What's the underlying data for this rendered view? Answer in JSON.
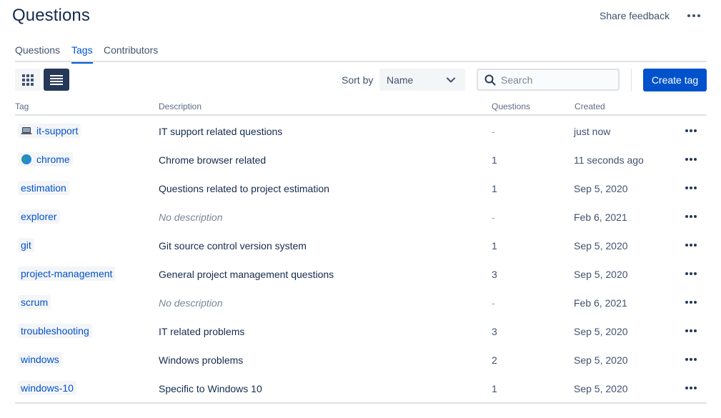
{
  "header": {
    "title": "Questions",
    "share_feedback": "Share feedback",
    "more_icon": "more-horizontal-icon"
  },
  "tabs": [
    {
      "label": "Questions",
      "active": false
    },
    {
      "label": "Tags",
      "active": true
    },
    {
      "label": "Contributors",
      "active": false
    }
  ],
  "toolbar": {
    "grid_view_icon": "grid-view-icon",
    "list_view_icon": "list-view-icon",
    "active_view": "list",
    "sort_label": "Sort by",
    "sort_value": "Name",
    "search_placeholder": "Search",
    "search_value": "",
    "create_label": "Create tag"
  },
  "table": {
    "columns": [
      "Tag",
      "Description",
      "Questions",
      "Created"
    ],
    "rows": [
      {
        "tag": "it-support",
        "icon": "laptop-icon",
        "description": "IT support related questions",
        "questions": "-",
        "created": "just now"
      },
      {
        "tag": "chrome",
        "icon": "globe-icon",
        "description": "Chrome browser related",
        "questions": "1",
        "created": "11 seconds ago"
      },
      {
        "tag": "estimation",
        "icon": "",
        "description": "Questions related to project estimation",
        "questions": "1",
        "created": "Sep 5, 2020"
      },
      {
        "tag": "explorer",
        "icon": "",
        "description": "No description",
        "questions": "-",
        "created": "Feb 6, 2021"
      },
      {
        "tag": "git",
        "icon": "",
        "description": "Git source control version system",
        "questions": "1",
        "created": "Sep 5, 2020"
      },
      {
        "tag": "project-management",
        "icon": "",
        "description": "General project management questions",
        "questions": "3",
        "created": "Sep 5, 2020"
      },
      {
        "tag": "scrum",
        "icon": "",
        "description": "No description",
        "questions": "-",
        "created": "Feb 6, 2021"
      },
      {
        "tag": "troubleshooting",
        "icon": "",
        "description": "IT related problems",
        "questions": "3",
        "created": "Sep 5, 2020"
      },
      {
        "tag": "windows",
        "icon": "",
        "description": "Windows problems",
        "questions": "2",
        "created": "Sep 5, 2020"
      },
      {
        "tag": "windows-10",
        "icon": "",
        "description": "Specific to Windows 10",
        "questions": "1",
        "created": "Sep 5, 2020"
      }
    ]
  },
  "colors": {
    "primary": "#0052cc",
    "text": "#172b4d",
    "subtle": "#42526e",
    "active_view_bg": "#253858"
  }
}
